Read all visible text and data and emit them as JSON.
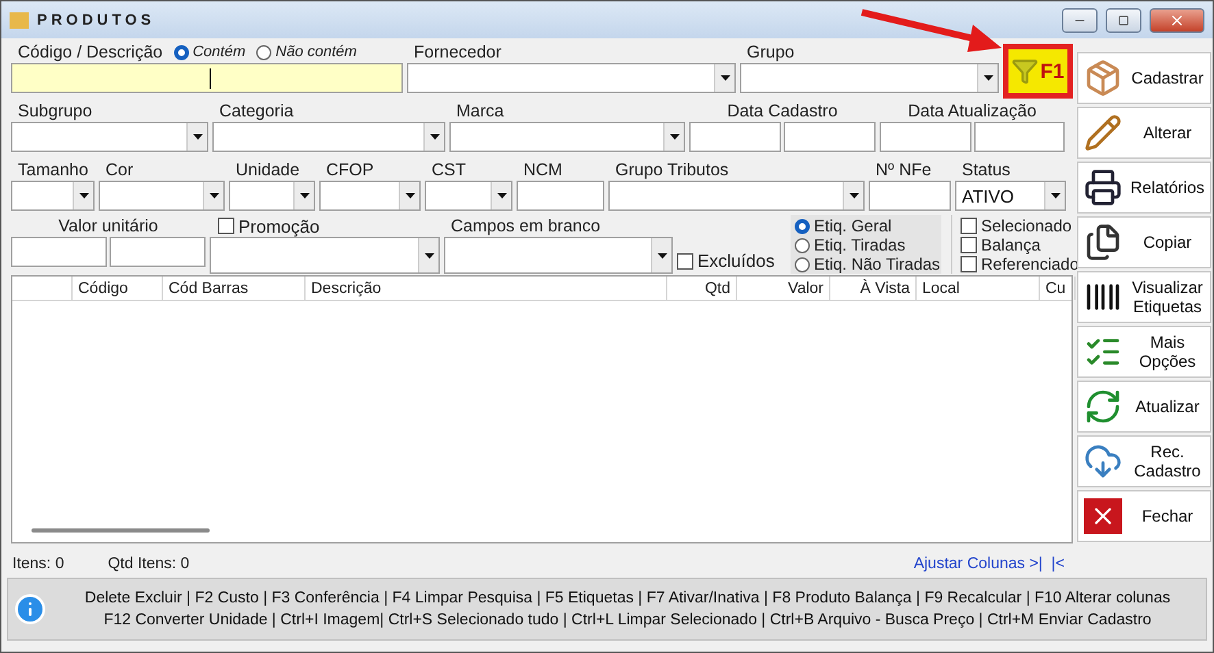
{
  "window": {
    "title": "PRODUTOS"
  },
  "filter_rows": [
    {
      "fields": [
        {
          "kind": "search",
          "label": "Código / Descrição",
          "focused": true,
          "options": [
            {
              "label": "Contém",
              "selected": true
            },
            {
              "label": "Não contém",
              "selected": false
            }
          ]
        },
        {
          "kind": "combo",
          "label": "Fornecedor"
        },
        {
          "kind": "combo",
          "label": "Grupo"
        },
        {
          "kind": "shortcut",
          "label": "F1"
        }
      ]
    },
    {
      "fields": [
        {
          "kind": "combo",
          "label": "Subgrupo"
        },
        {
          "kind": "combo",
          "label": "Categoria"
        },
        {
          "kind": "combo",
          "label": "Marca"
        },
        {
          "kind": "pair",
          "label": "Data Cadastro"
        },
        {
          "kind": "pair",
          "label": "Data Atualização"
        }
      ]
    },
    {
      "fields": [
        {
          "kind": "combo",
          "label": "Tamanho"
        },
        {
          "kind": "combo",
          "label": "Cor"
        },
        {
          "kind": "combo",
          "label": "Unidade"
        },
        {
          "kind": "combo",
          "label": "CFOP"
        },
        {
          "kind": "combo",
          "label": "CST"
        },
        {
          "kind": "text",
          "label": "NCM"
        },
        {
          "kind": "combo",
          "label": "Grupo Tributos"
        },
        {
          "kind": "text",
          "label": "Nº NFe"
        },
        {
          "kind": "combo",
          "label": "Status",
          "value": "ATIVO"
        }
      ]
    },
    {
      "fields": [
        {
          "kind": "pair",
          "label": "Valor unitário"
        },
        {
          "kind": "check-combo",
          "label": "Promoção",
          "checked": false
        },
        {
          "kind": "combo",
          "label": "Campos em branco"
        },
        {
          "kind": "check",
          "label": "Excluídos",
          "checked": false
        },
        {
          "kind": "radios",
          "options": [
            {
              "label": "Etiq. Geral",
              "selected": true
            },
            {
              "label": "Etiq. Tiradas",
              "selected": false
            },
            {
              "label": "Etiq. Não Tiradas",
              "selected": false
            }
          ]
        },
        {
          "kind": "checks",
          "options": [
            {
              "label": "Selecionado",
              "checked": false
            },
            {
              "label": "Balança",
              "checked": false
            },
            {
              "label": "Referenciado",
              "checked": false
            }
          ]
        }
      ]
    }
  ],
  "table": {
    "columns": [
      {
        "label": "Código"
      },
      {
        "label": "Cód Barras"
      },
      {
        "label": "Descrição"
      },
      {
        "label": "Qtd"
      },
      {
        "label": "Valor"
      },
      {
        "label": "À Vista"
      },
      {
        "label": "Local"
      },
      {
        "label": "Cu"
      }
    ]
  },
  "actions": [
    {
      "kind": "register",
      "label": "Cadastrar"
    },
    {
      "kind": "edit",
      "label": "Alterar"
    },
    {
      "kind": "reports",
      "label": "Relatórios"
    },
    {
      "kind": "copy",
      "label": "Copiar"
    },
    {
      "kind": "labels",
      "label": "Visualizar Etiquetas"
    },
    {
      "kind": "options",
      "label": "Mais Opções"
    },
    {
      "kind": "refresh",
      "label": "Atualizar"
    },
    {
      "kind": "cloud",
      "label": "Rec. Cadastro"
    },
    {
      "kind": "close",
      "label": "Fechar"
    }
  ],
  "status": {
    "items": "Itens: 0",
    "qty": "Qtd Itens: 0",
    "link": "Ajustar Colunas >|  |<"
  },
  "shortcuts": [
    "Delete Excluir | F2 Custo | F3 Conferência | F4 Limpar Pesquisa | F5 Etiquetas | F7 Ativar/Inativa | F8 Produto Balança | F9 Recalcular | F10 Alterar colunas",
    "F12 Converter Unidade | Ctrl+I Imagem| Ctrl+S Selecionado tudo | Ctrl+L Limpar Selecionado | Ctrl+B Arquivo - Busca Preço | Ctrl+M Enviar Cadastro"
  ]
}
